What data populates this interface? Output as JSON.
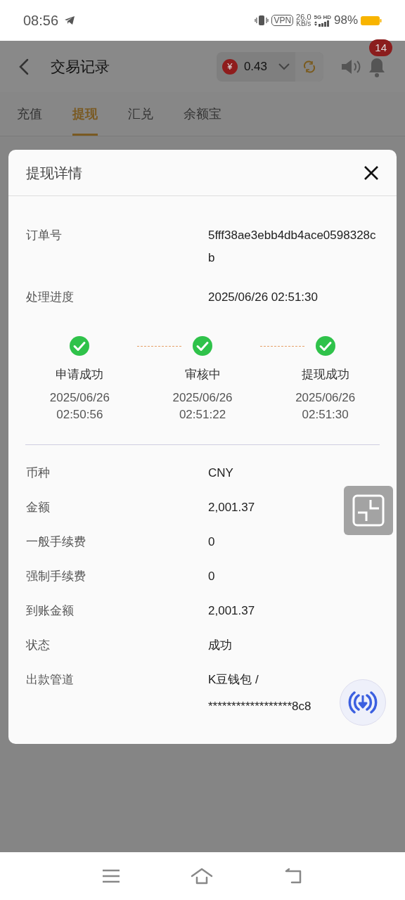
{
  "status_bar": {
    "time": "08:56",
    "vpn": "VPN",
    "speed": "26.0",
    "speed_unit": "KB/s",
    "network": "5G HD",
    "battery": "98%"
  },
  "header": {
    "title": "交易记录",
    "balance": "0.43",
    "currency_symbol": "¥",
    "notifications": "14"
  },
  "tabs": [
    {
      "label": "充值",
      "selected": false
    },
    {
      "label": "提现",
      "selected": true
    },
    {
      "label": "汇兑",
      "selected": false
    },
    {
      "label": "余额宝",
      "selected": false
    }
  ],
  "dialog": {
    "title": "提现详情",
    "top_fields": [
      {
        "label": "订单号",
        "value": "5fff38ae3ebb4db4ace0598328cb"
      },
      {
        "label": "处理进度",
        "value": "2025/06/26 02:51:30"
      }
    ],
    "steps": [
      {
        "label": "申请成功",
        "date": "2025/06/26",
        "time": "02:50:56",
        "done": true
      },
      {
        "label": "审核中",
        "date": "2025/06/26",
        "time": "02:51:22",
        "done": true
      },
      {
        "label": "提现成功",
        "date": "2025/06/26",
        "time": "02:51:30",
        "done": true
      }
    ],
    "fields": [
      {
        "label": "币种",
        "value": "CNY"
      },
      {
        "label": "金额",
        "value": "2,001.37"
      },
      {
        "label": "一般手续费",
        "value": "0"
      },
      {
        "label": "强制手续费",
        "value": "0"
      },
      {
        "label": "到账金额",
        "value": "2,001.37"
      },
      {
        "label": "状态",
        "value": "成功"
      },
      {
        "label": "出款管道",
        "value": "K豆钱包 /",
        "value_line2": "******************8c8"
      }
    ]
  }
}
